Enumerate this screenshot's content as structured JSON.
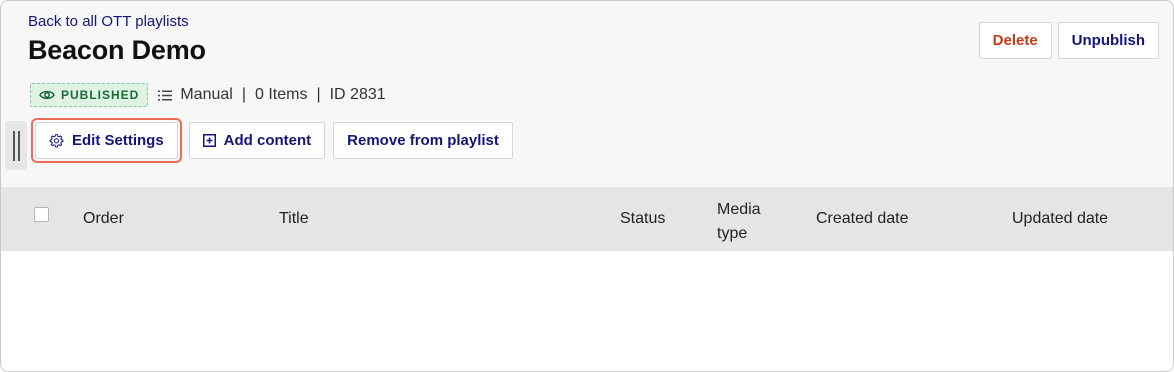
{
  "header": {
    "back_link": "Back to all OTT playlists",
    "title": "Beacon Demo",
    "delete_label": "Delete",
    "unpublish_label": "Unpublish"
  },
  "meta": {
    "status_badge": "PUBLISHED",
    "mode": "Manual",
    "separator": "|",
    "items": "0 Items",
    "id": "ID 2831"
  },
  "toolbar": {
    "edit_settings": "Edit Settings",
    "add_content": "Add content",
    "remove_from_playlist": "Remove from playlist"
  },
  "table": {
    "columns": {
      "order": "Order",
      "title": "Title",
      "status": "Status",
      "media_type": "Media type",
      "created_date": "Created date",
      "updated_date": "Updated date"
    }
  },
  "icons": {
    "status": "eye-icon",
    "mode": "list-icon",
    "edit_settings": "gear-icon",
    "add_content": "plus-square-icon",
    "panel_toggle": "drag-handle-icon"
  },
  "colors": {
    "link": "#14147a",
    "delete": "#c23b14",
    "published_bg": "#dff2e4",
    "published_text": "#1a6b3a",
    "highlight": "#ee6a5a",
    "header_bg": "#f7f7f7",
    "table_head_bg": "#e5e5e5"
  }
}
